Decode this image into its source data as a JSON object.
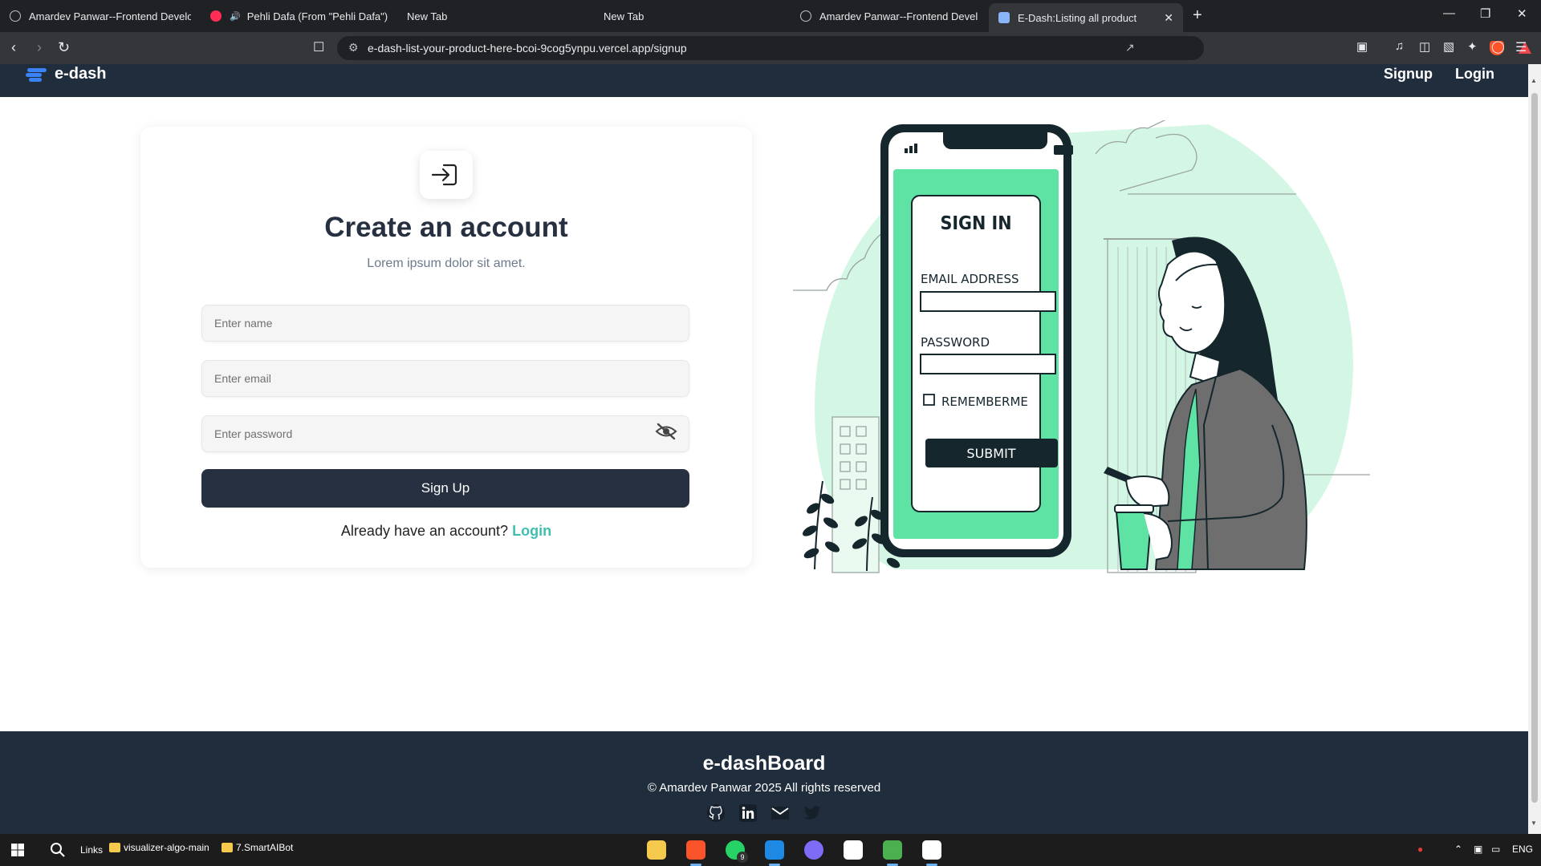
{
  "browser": {
    "tabs": [
      {
        "title": "Amardev Panwar--Frontend Developer",
        "icon": "globe-icon",
        "active": false
      },
      {
        "title": "Pehli Dafa (From \"Pehli Dafa\") - YouTube",
        "icon": "youtube-icon",
        "active": false
      },
      {
        "title": "New Tab",
        "icon": "none",
        "active": false
      },
      {
        "title": "New Tab",
        "icon": "none",
        "active": false
      },
      {
        "title": "Amardev Panwar--Frontend Developer",
        "icon": "globe-icon",
        "active": false
      },
      {
        "title": "E-Dash:Listing all product",
        "icon": "page-icon",
        "active": true
      }
    ],
    "new_tab_glyph": "+",
    "window_controls": {
      "minimize": "—",
      "restore": "❐",
      "close": "✕"
    },
    "address": "e-dash-list-your-product-here-bcoi-9cog5ynpu.vercel.app/signup"
  },
  "navbar": {
    "brand": "e-dash",
    "signup": "Signup",
    "login": "Login"
  },
  "signup": {
    "title": "Create an account",
    "subtitle": "Lorem ipsum dolor sit amet.",
    "name_placeholder": "Enter name",
    "email_placeholder": "Enter email",
    "password_placeholder": "Enter password",
    "submit_label": "Sign Up",
    "have_account_text": "Already have an account?",
    "login_link": "Login"
  },
  "illustration": {
    "heading": "SIGN IN",
    "email_label": "EMAIL ADDRESS",
    "password_label": "PASSWORD",
    "remember_label": "REMEMBERME",
    "submit_label": "SUBMIT"
  },
  "footer": {
    "title": "e-dashBoard",
    "copyright": "© Amardev Panwar 2025 All rights reserved",
    "socials": [
      "github-icon",
      "linkedin-icon",
      "mail-icon",
      "twitter-icon"
    ]
  },
  "taskbar": {
    "links_label": "Links",
    "folder1": "visualizer-algo-main",
    "folder2": "7.SmartAIBot",
    "whatsapp_badge": "9",
    "language": "ENG"
  },
  "colors": {
    "navy": "#1f2d3d",
    "button": "#263040",
    "accent_teal": "#3fbfb0",
    "illustration_green": "#5ee3a4",
    "mint_blob": "#d3f7e4"
  }
}
